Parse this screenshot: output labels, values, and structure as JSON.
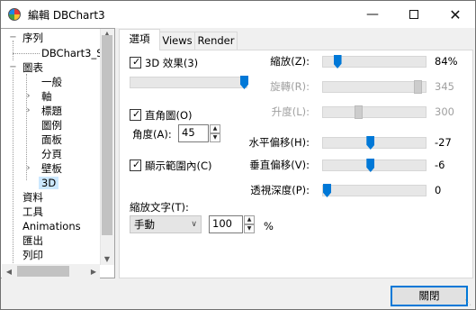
{
  "window": {
    "title": "編輯 DBChart3"
  },
  "tree": {
    "items": [
      {
        "label": "序列",
        "expander": "−"
      },
      {
        "label": "DBChart3_Se"
      },
      {
        "label": "圖表",
        "expander": "−"
      },
      {
        "label": "一般"
      },
      {
        "label": "軸",
        "expander": "›"
      },
      {
        "label": "標題",
        "expander": "›"
      },
      {
        "label": "圖例"
      },
      {
        "label": "面板"
      },
      {
        "label": "分頁"
      },
      {
        "label": "壁板",
        "expander": "›"
      },
      {
        "label": "3D"
      },
      {
        "label": "資料"
      },
      {
        "label": "工具"
      },
      {
        "label": "Animations"
      },
      {
        "label": "匯出"
      },
      {
        "label": "列印"
      }
    ],
    "selected": "3D"
  },
  "tabs": [
    {
      "label": "選項",
      "active": true
    },
    {
      "label": "Views"
    },
    {
      "label": "Render"
    }
  ],
  "options": {
    "effect3d": {
      "label": "3D 效果(3)",
      "checked": true,
      "slider_level": 1.0
    },
    "orthogonal": {
      "label": "直角圖(O)",
      "checked": true
    },
    "angle": {
      "label": "角度(A):",
      "value": "45"
    },
    "clip": {
      "label": "顯示範圍內(C)",
      "checked": true
    },
    "zoom_text": {
      "label": "縮放文字(T):",
      "mode": "手動",
      "value": "100",
      "unit": "%"
    }
  },
  "sliders": [
    {
      "label": "縮放(Z):",
      "value": "84%",
      "enabled": true,
      "level": 0.11
    },
    {
      "label": "旋轉(R):",
      "value": "345",
      "enabled": false,
      "level": 0.96
    },
    {
      "label": "升度(L):",
      "value": "300",
      "enabled": false,
      "level": 0.33
    },
    {
      "label": "水平偏移(H):",
      "value": "-27",
      "enabled": true,
      "level": 0.46
    },
    {
      "label": "垂直偏移(V):",
      "value": "-6",
      "enabled": true,
      "level": 0.46
    },
    {
      "label": "透視深度(P):",
      "value": "0",
      "enabled": true,
      "level": 0.0
    }
  ],
  "footer": {
    "close_label": "關閉"
  },
  "icons": {
    "app": "chart-app-icon",
    "minimize": "minimize-icon",
    "maximize": "maximize-icon",
    "close": "close-icon"
  },
  "colors": {
    "accent": "#0078d7",
    "selection": "#cce8ff"
  }
}
